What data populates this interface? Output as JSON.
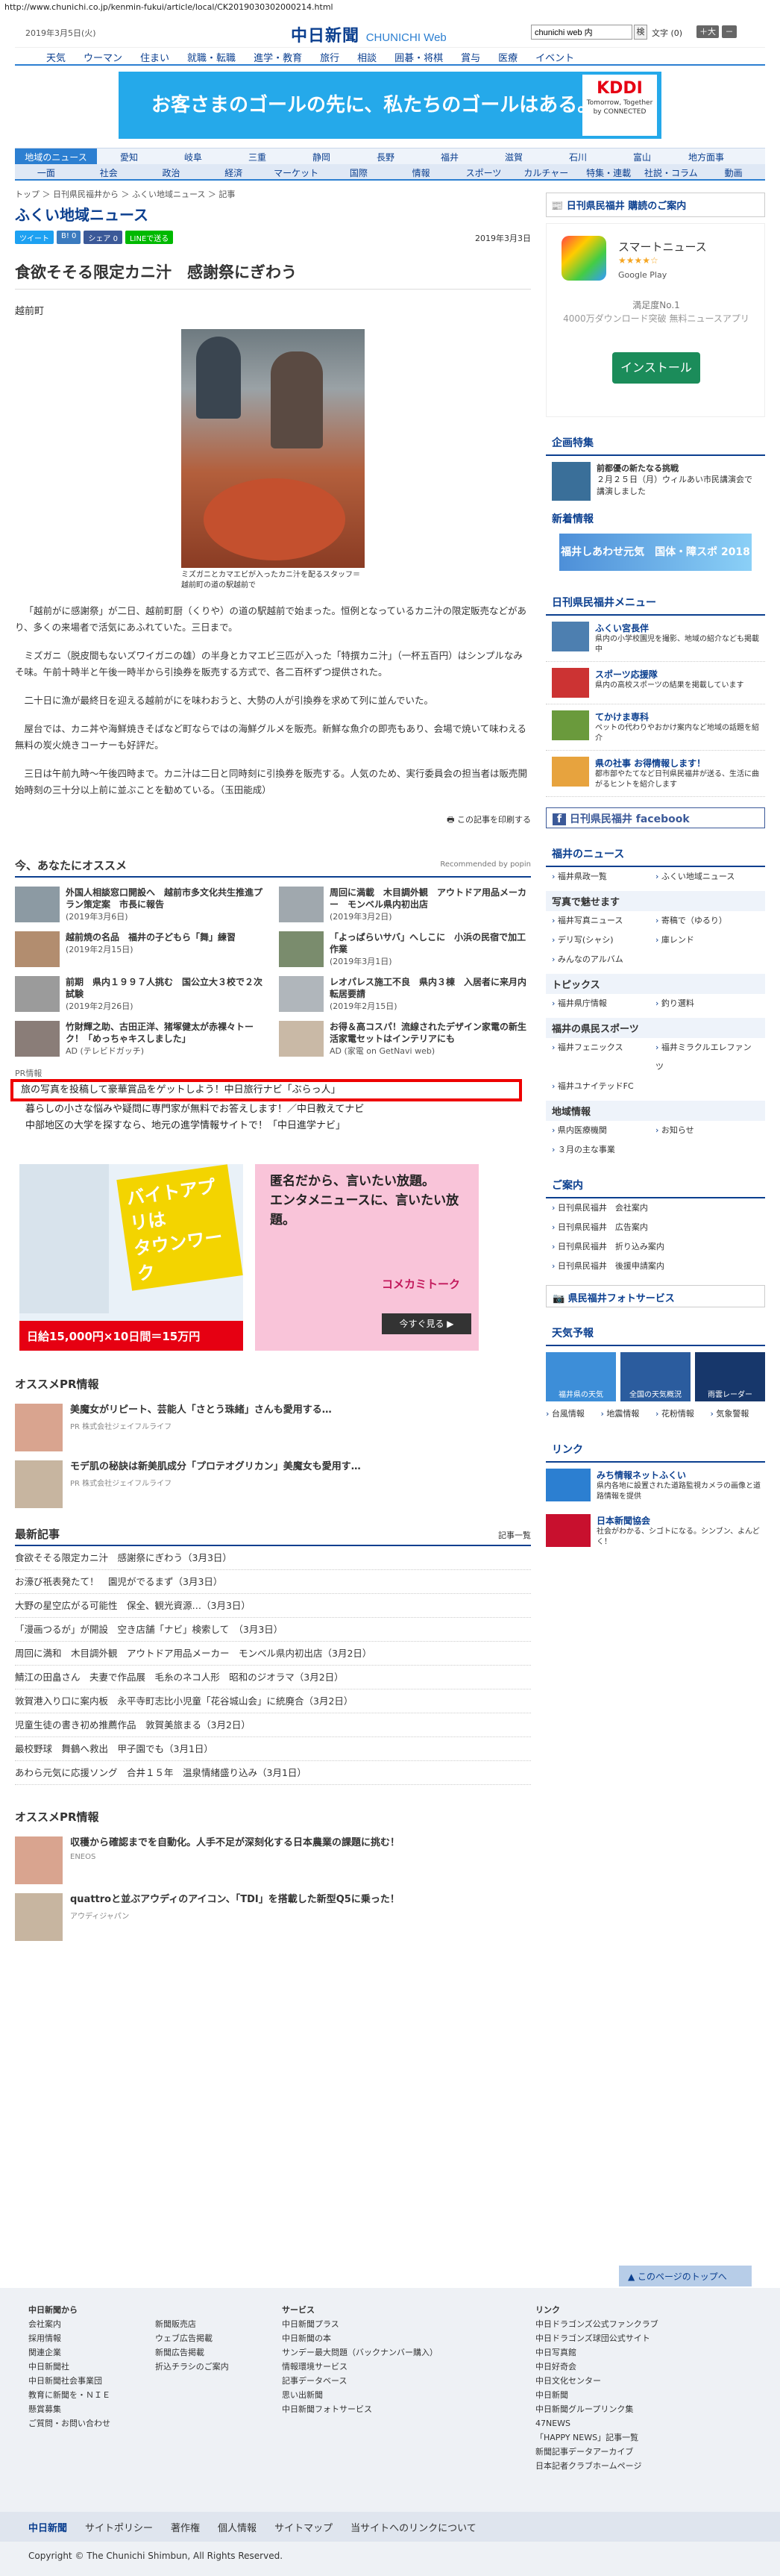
{
  "url": "http://www.chunichi.co.jp/kenmin-fukui/article/local/CK2019030302000214.html",
  "header": {
    "date": "2019年3月5日(火)",
    "logo": "中日新聞",
    "logo_sub": "CHUNICHI Web",
    "search_value": "chunichi web 内",
    "search_btn": "検",
    "font_label": "文字 (0)",
    "font_plus": "＋大",
    "font_minus": "－"
  },
  "gnav": [
    "天気",
    "ウーマン",
    "住まい",
    "就職・転職",
    "進学・教育",
    "旅行",
    "相談",
    "囲碁・将棋",
    "賞与",
    "医療",
    "イベント"
  ],
  "banner": {
    "text": "お客さまのゴールの先に、私たちのゴールはある。",
    "brand": "KDDI",
    "brand_sub": "Tomorrow, Together",
    "brand_sub2": "by CONNECTED"
  },
  "region_nav": [
    "地域のニュース",
    "愛知",
    "岐阜",
    "三重",
    "静岡",
    "長野",
    "福井",
    "滋賀",
    "石川",
    "富山",
    "地方面事"
  ],
  "cat_nav": [
    "一面",
    "社会",
    "政治",
    "経済",
    "マーケット",
    "国際",
    "情報",
    "スポーツ",
    "カルチャー",
    "特集・連載",
    "社説・コラム",
    "動画"
  ],
  "breadcrumb": "トップ ＞ 日刊県民福井から ＞ ふくい地域ニュース ＞ 記事",
  "page_title": "ふくい地域ニュース",
  "social": [
    "ツイート",
    "B! 0",
    "シェア 0",
    "LINEで送る"
  ],
  "article": {
    "date": "2019年3月3日",
    "headline": "食欲そそる限定カニ汁　感謝祭にぎわう",
    "location": "越前町",
    "caption": "ミズガニとカマエビが入ったカニ汁を配るスタッフ＝越前町の道の駅越前で",
    "paragraphs": [
      "「越前がに感謝祭」が二日、越前町厨（くりや）の道の駅越前で始まった。恒例となっているカニ汁の限定販売などがあり、多くの来場者で活気にあふれていた。三日まで。",
      "ミズガニ（脱皮間もないズワイガニの雄）の半身とカマエビ三匹が入った「特撰カニ汁」（一杯五百円）はシンプルなみそ味。午前十時半と午後一時半から引換券を販売する方式で、各二百杯ずつ提供された。",
      "二十日に漁が最終日を迎える越前がにを味わおうと、大勢の人が引換券を求めて列に並んでいた。",
      "屋台では、カニ丼や海鮮焼きそばなど町ならではの海鮮グルメを販売。新鮮な魚介の即売もあり、会場で焼いて味わえる無料の炭火焼きコーナーも好評だ。",
      "三日は午前九時～午後四時まで。カニ汁は二日と同時刻に引換券を販売する。人気のため、実行委員会の担当者は販売開始時刻の三十分以上前に並ぶことを勧めている。（玉田能成）"
    ],
    "print": "この記事を印刷する"
  },
  "recommend": {
    "title": "今、あなたにオススメ",
    "powered": "Recommended by popin",
    "items": [
      {
        "t": "外国人相談窓口開設へ　越前市多文化共生推進プラン策定案　市長に報告",
        "d": "(2019年3月6日)"
      },
      {
        "t": "周回に満載　木目調外観　アウトドア用品メーカー　モンベル県内初出店",
        "d": "(2019年3月2日)"
      },
      {
        "t": "越前焼の名品　福井の子どもら「舞」練習",
        "d": "(2019年2月15日)"
      },
      {
        "t": "「よっぱらいサバ」へしこに　小浜の民宿で加工作業",
        "d": "(2019年3月1日)"
      },
      {
        "t": "前期　県内１９９７人挑む　国公立大３校で２次試験",
        "d": "(2019年2月26日)"
      },
      {
        "t": "レオパレス施工不良　県内３棟　入居者に来月内転居要請",
        "d": "(2019年2月15日)"
      },
      {
        "t": "竹財輝之助、古田正洋、猪塚健太が赤裸々トーク！「めっちゃキスしました」",
        "d": "AD (テレビドガッチ)"
      },
      {
        "t": "お得＆高コスパ！流線されたデザイン家電の新生活家電セットはインテリアにも",
        "d": "AD (家電 on GetNavi web)"
      }
    ]
  },
  "pr": {
    "label": "PR情報",
    "lines": [
      "旅の写真を投稿して豪華賞品をゲットしよう！中日旅行ナビ「ぶらっ人」",
      "暮らしの小さな悩みや疑問に専門家が無料でお答えします！／中日教えてナビ",
      "中部地区の大学を探すなら、地元の進学情報サイトで！「中日進学ナビ」"
    ]
  },
  "ads": {
    "ad1_line1": "バイトアプリは",
    "ad1_line2": "タウンワーク",
    "ad1_price": "日給15,000円×10日間＝15万円",
    "ad2_line1": "匿名だから、言いたい放題。",
    "ad2_line2": "エンタメニュースに、言いたい放題。",
    "ad2_brand": "コメカミトーク",
    "ad2_cta": "今すぐ見る ▶"
  },
  "osusume_pr": {
    "title": "オススメPR情報",
    "items": [
      {
        "t": "美魔女がリピート、芸能人「さとう珠緒」さんも愛用する…",
        "d": "PR 株式会社ジェイフルライフ"
      },
      {
        "t": "モデ肌の秘訣は新美肌成分「プロテオグリカン」美魔女も愛用す…",
        "d": "PR 株式会社ジェイフルライフ"
      }
    ]
  },
  "latest": {
    "title": "最新記事",
    "more": "記事一覧",
    "rows": [
      "食欲そそる限定カニ汁　感謝祭にぎわう（3月3日）",
      "お濠び祇表発たて！　園児がでるまず（3月3日）",
      "大野の星空広がる可能性　保全、観光資源…（3月3日）",
      "「漫画つるが」が開設　空き店舗「ナビ」検索して　（3月3日）",
      "周回に満和　木目調外観　アウトドア用品メーカー　モンベル県内初出店（3月2日）",
      "鯖江の田畠さん　夫妻で作品展　毛糸のネコ人形　昭和のジオラマ（3月2日）",
      "敦賀港入り口に案内板　永平寺町志比小児童「花谷城山会」に統廃合（3月2日）",
      "児童生徒の書き初め推薦作品　敦賀美旅まる（3月2日）",
      "最校野球　舞鶴へ救出　甲子園でも（3月1日）",
      "あわら元気に応援ソング　合井１５年　温泉情緒盛り込み（3月1日）"
    ]
  },
  "osusume_pr2": {
    "title": "オススメPR情報",
    "items": [
      {
        "t": "収穫から確認までを自動化。人手不足が深刻化する日本農業の課題に挑む！",
        "d": "ENEOS"
      },
      {
        "t": "quattroと並ぶアウディのアイコン、「TDI」を搭載した新型Q5に乗った！",
        "d": "アウディジャパン"
      }
    ]
  },
  "sidebar": {
    "subscribe": "日刊県民福井 購読のご案内",
    "app_name": "スマートニュース",
    "app_rating": "★★★★☆",
    "app_store": "Google Play",
    "app_desc1": "満足度No.1",
    "app_desc2": "4000万ダウンロード突破 無料ニュースアプリ",
    "app_install": "インストール",
    "kikaku": "企画特集",
    "kikaku_t": "前都優の新たなる挑戦",
    "kikaku_d": "２月２５日（月）ウィルあい市民講演会で講演しました",
    "shinchaku": "新着情報",
    "shinchaku_banner": "福井しあわせ元気　国体・障スポ 2018",
    "menu_title": "日刊県民福井メニュー",
    "menu": [
      {
        "t": "ふくい宮長伴",
        "d": "県内の小学校園児を撮影、地域の紹介なども掲載中"
      },
      {
        "t": "スポーツ応援隊",
        "d": "県内の高校スポーツの結果を掲載しています"
      },
      {
        "t": "てかけま専科",
        "d": "ペットの代わりやおかけ案内など地域の話題を紹介"
      },
      {
        "t": "県の社事 お得情報します！",
        "d": "都市部やたてなど日刊県民福井が送る、生活に曲がるヒントを紹介します"
      }
    ],
    "facebook": "日刊県民福井 facebook",
    "news_title": "福井のニュース",
    "news": [
      "福井県政一覧",
      "ふくい地域ニュース"
    ],
    "photo_title": "写真で魅せます",
    "photo": [
      "福井写真ニュース",
      "寄稿で（ゆるり）",
      "デリ写(シャシ)",
      "庫レンド",
      "みんなのアルバム"
    ],
    "topics_title": "トピックス",
    "topics": [
      "福井県庁情報",
      "釣り選料"
    ],
    "sports_title": "福井の県民スポーツ",
    "sports": [
      "福井フェニックス",
      "福井ミラクルエレファンツ",
      "福井ユナイテッドFC"
    ],
    "chiiki_title": "地域情報",
    "chiiki": [
      "県内医療機関",
      "お知らせ",
      "３月の主な事業"
    ],
    "annai_title": "ご案内",
    "annai": [
      "日刊県民福井　会社案内",
      "日刊県民福井　広告案内",
      "日刊県民福井　折り込み案内",
      "日刊県民福井　後援申請案内"
    ],
    "photo_service": "県民福井フォトサービス",
    "weather_title": "天気予報",
    "weather": [
      "福井県の天気",
      "全国の天気概況",
      "雨雲レーダー"
    ],
    "weather_links": [
      "台風情報",
      "地震情報",
      "花粉情報",
      "気象警報"
    ],
    "link_title": "リンク",
    "links": [
      {
        "t": "みち情報ネットふくい",
        "d": "県内各地に設置された道路監視カメラの画像と道路情報を提供"
      },
      {
        "t": "日本新聞協会",
        "d": "社会がわかる、シゴトになる。シンブン、よんどく！"
      }
    ]
  },
  "to_top": "このページのトップへ",
  "footer": {
    "cols": [
      [
        "中日新聞から",
        "会社案内",
        "採用情報",
        "関連企業",
        "中日新聞社",
        "中日新聞社会事業団",
        "教育に新聞を・ＮＩＥ",
        "懸賞募集",
        "ご質問・お問い合わせ"
      ],
      [
        "",
        "新聞販売店",
        "ウェブ広告掲載",
        "新聞広告掲載",
        "折込チラシのご案内"
      ],
      [
        "サービス",
        "中日新聞プラス",
        "中日新聞の本",
        "サンデー最大問題（バックナンバー購入）",
        "情報環境サービス",
        "記事データベース",
        "思い出新聞",
        "中日新聞フォトサービス"
      ],
      [
        "リンク",
        "中日ドラゴンズ公式ファンクラブ",
        "中日ドラゴンズ球団公式サイト",
        "中日写真館",
        "中日好奇会",
        "中日文化センター",
        "中日新聞",
        "中日新聞グループリンク集",
        "47NEWS",
        "「HAPPY NEWS」記事一覧",
        "新聞記事データアーカイブ",
        "日本記者クラブホームページ"
      ]
    ],
    "nav": [
      "中日新聞",
      "サイトポリシー",
      "著作権",
      "個人情報",
      "サイトマップ",
      "当サイトへのリンクについて"
    ],
    "copyright": "Copyright © The Chunichi Shimbun, All Rights Reserved."
  }
}
